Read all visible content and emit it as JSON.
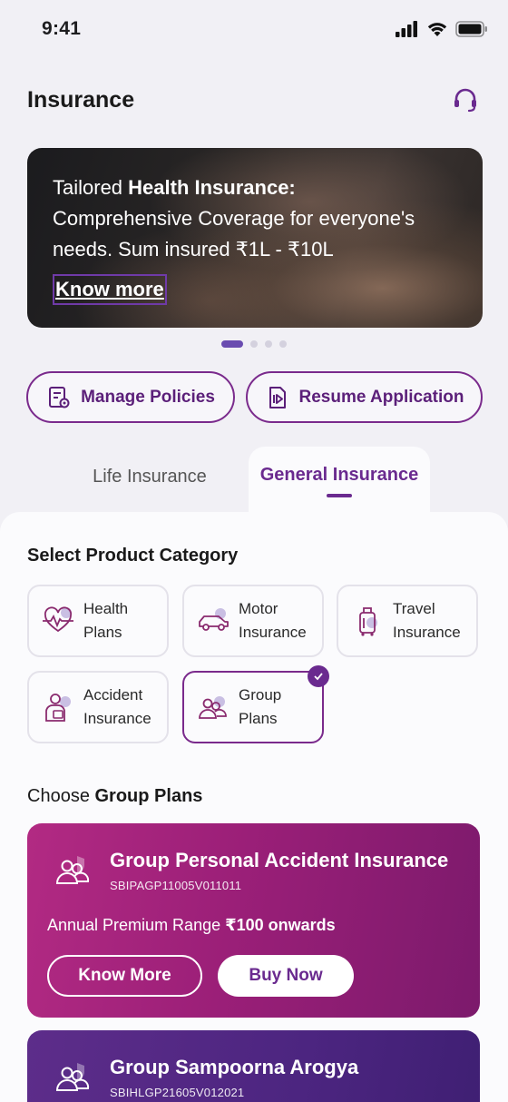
{
  "status_bar": {
    "time": "9:41"
  },
  "header": {
    "title": "Insurance",
    "support_icon": "headset-icon"
  },
  "banner": {
    "line1_prefix": "Tailored ",
    "line1_bold": "Health Insurance:",
    "line2": "Comprehensive Coverage for everyone's",
    "line3": "needs. Sum insured ₹1L - ₹10L",
    "link": "Know more",
    "pagination": {
      "total": 4,
      "active_index": 0
    }
  },
  "quick_actions": [
    {
      "label": "Manage Policies",
      "icon": "policy-settings-icon"
    },
    {
      "label": "Resume Application",
      "icon": "resume-document-icon"
    }
  ],
  "tabs": [
    {
      "label": "Life Insurance",
      "selected": false
    },
    {
      "label": "General Insurance",
      "selected": true
    }
  ],
  "category_section": {
    "title": "Select Product Category"
  },
  "categories": [
    {
      "line1": "Health",
      "line2": "Plans",
      "icon": "heart-pulse-icon",
      "selected": false
    },
    {
      "line1": "Motor",
      "line2": "Insurance",
      "icon": "car-icon",
      "selected": false
    },
    {
      "line1": "Travel",
      "line2": "Insurance",
      "icon": "luggage-icon",
      "selected": false
    },
    {
      "line1": "Accident",
      "line2": "Insurance",
      "icon": "injured-person-icon",
      "selected": false
    },
    {
      "line1": "Group",
      "line2": "Plans",
      "icon": "group-people-icon",
      "selected": true
    }
  ],
  "plans_section": {
    "title_prefix": "Choose ",
    "title_bold": "Group Plans"
  },
  "plans": [
    {
      "name": "Group Personal Accident Insurance",
      "code": "SBIPAGP11005V011011",
      "premium_prefix": "Annual Premium Range ",
      "premium_bold": "₹100 onwards",
      "know_more": "Know More",
      "buy_now": "Buy Now"
    },
    {
      "name": "Group Sampoorna Arogya",
      "code": "SBIHLGP21605V012021"
    }
  ],
  "colors": {
    "brand_purple": "#6a2a8f",
    "card_magenta": "#a3237d",
    "card_violet": "#4f2682",
    "background": "#f1f0f5"
  }
}
